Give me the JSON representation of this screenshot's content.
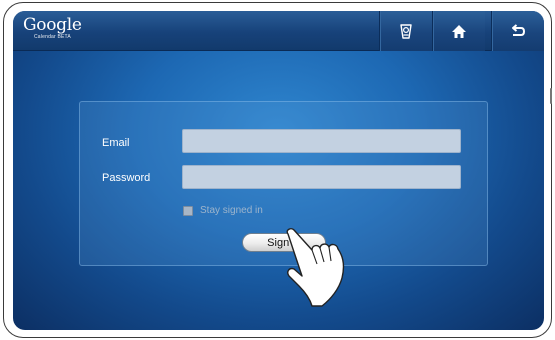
{
  "app": {
    "brand": "Google",
    "brand_sub": "Calendar BETA"
  },
  "toolbar": {
    "buttons": [
      {
        "name": "task-manager",
        "icon": "task-manager-icon"
      },
      {
        "name": "home",
        "icon": "home-icon"
      },
      {
        "name": "back",
        "icon": "back-arrow-icon"
      }
    ]
  },
  "login": {
    "email_label": "Email",
    "email_value": "",
    "password_label": "Password",
    "password_value": "",
    "stay_signed_in_label": "Stay signed in",
    "stay_signed_in_checked": false,
    "sign_in_label": "Sign in"
  },
  "overlay": {
    "pointer": "tap-hand-icon"
  },
  "colors": {
    "background": "#1d68b3",
    "topbar": "#17427a",
    "field": "#c3d1e1",
    "text": "#ffffff"
  }
}
